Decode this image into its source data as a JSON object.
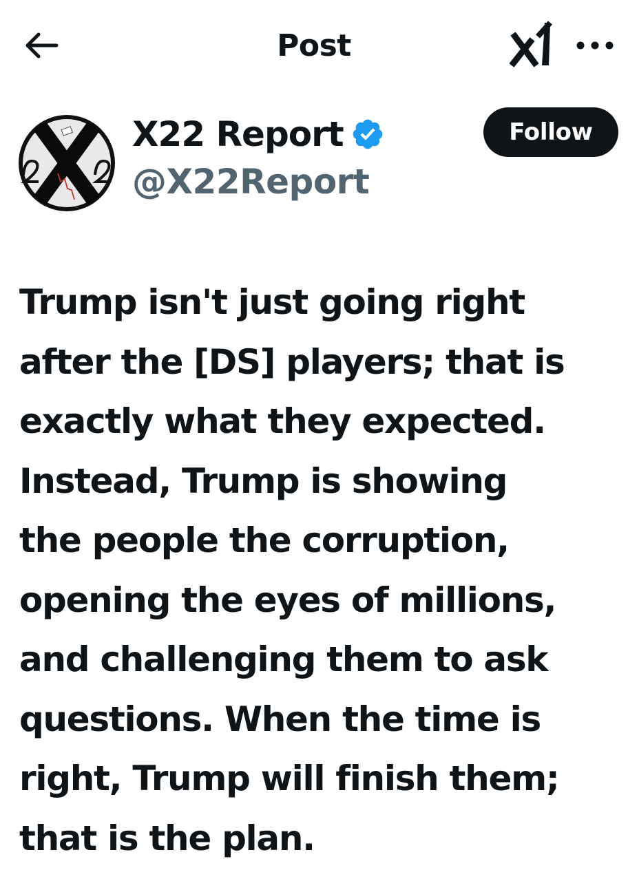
{
  "header": {
    "title": "Post",
    "back_icon": "arrow-left-icon",
    "grok_icon": "grok-icon",
    "more_icon": "more-horizontal-icon"
  },
  "author": {
    "display_name": "X22 Report",
    "handle": "@X22Report",
    "verified": true,
    "verified_color": "#1d9bf0",
    "avatar_icon": "x22-logo-avatar"
  },
  "follow_button": {
    "label": "Follow",
    "color": "#0f1419"
  },
  "post": {
    "text": "Trump isn't just going right\nafter the [DS] players; that is\nexactly what they expected.\nInstead, Trump is showing\nthe people the corruption,\nopening the eyes of millions,\nand challenging them to ask\nquestions. When the time is\nright, Trump will finish them;\nthat is the plan."
  },
  "colors": {
    "text_primary": "#0f1419",
    "text_secondary": "#536471",
    "background": "#ffffff"
  }
}
